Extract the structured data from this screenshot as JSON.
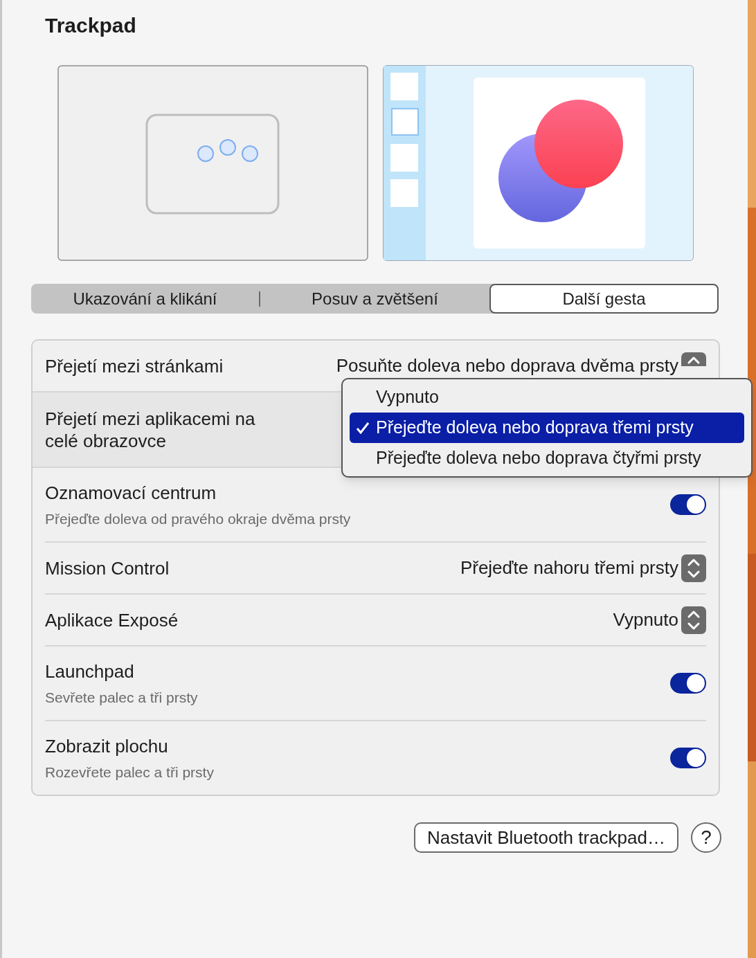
{
  "title": "Trackpad",
  "tabs": [
    {
      "label": "Ukazování a klikání",
      "selected": false
    },
    {
      "label": "Posuv a zvětšení",
      "selected": false
    },
    {
      "label": "Další gesta",
      "selected": true
    }
  ],
  "settings": [
    {
      "kind": "select",
      "label": "Přejetí mezi stránkami",
      "value": "Posuňte doleva nebo doprava dvěma prsty"
    },
    {
      "kind": "popup",
      "label": "Přejetí mezi aplikacemi na celé obrazovce",
      "options": [
        {
          "label": "Vypnuto",
          "selected": false
        },
        {
          "label": "Přejeďte doleva nebo doprava třemi prsty",
          "selected": true
        },
        {
          "label": "Přejeďte doleva nebo doprava čtyřmi prsty",
          "selected": false
        }
      ]
    },
    {
      "kind": "toggle",
      "label": "Oznamovací centrum",
      "subtitle": "Přejeďte doleva od pravého okraje dvěma prsty",
      "on": true
    },
    {
      "kind": "select",
      "label": "Mission Control",
      "value": "Přejeďte nahoru třemi prsty"
    },
    {
      "kind": "select",
      "label": "Aplikace Exposé",
      "value": "Vypnuto"
    },
    {
      "kind": "toggle",
      "label": "Launchpad",
      "subtitle": "Sevřete palec a tři prsty",
      "on": true
    },
    {
      "kind": "toggle",
      "label": "Zobrazit plochu",
      "subtitle": "Rozevřete palec a tři prsty",
      "on": true
    }
  ],
  "setup_button": "Nastavit Bluetooth trackpad…",
  "help_button": "?"
}
